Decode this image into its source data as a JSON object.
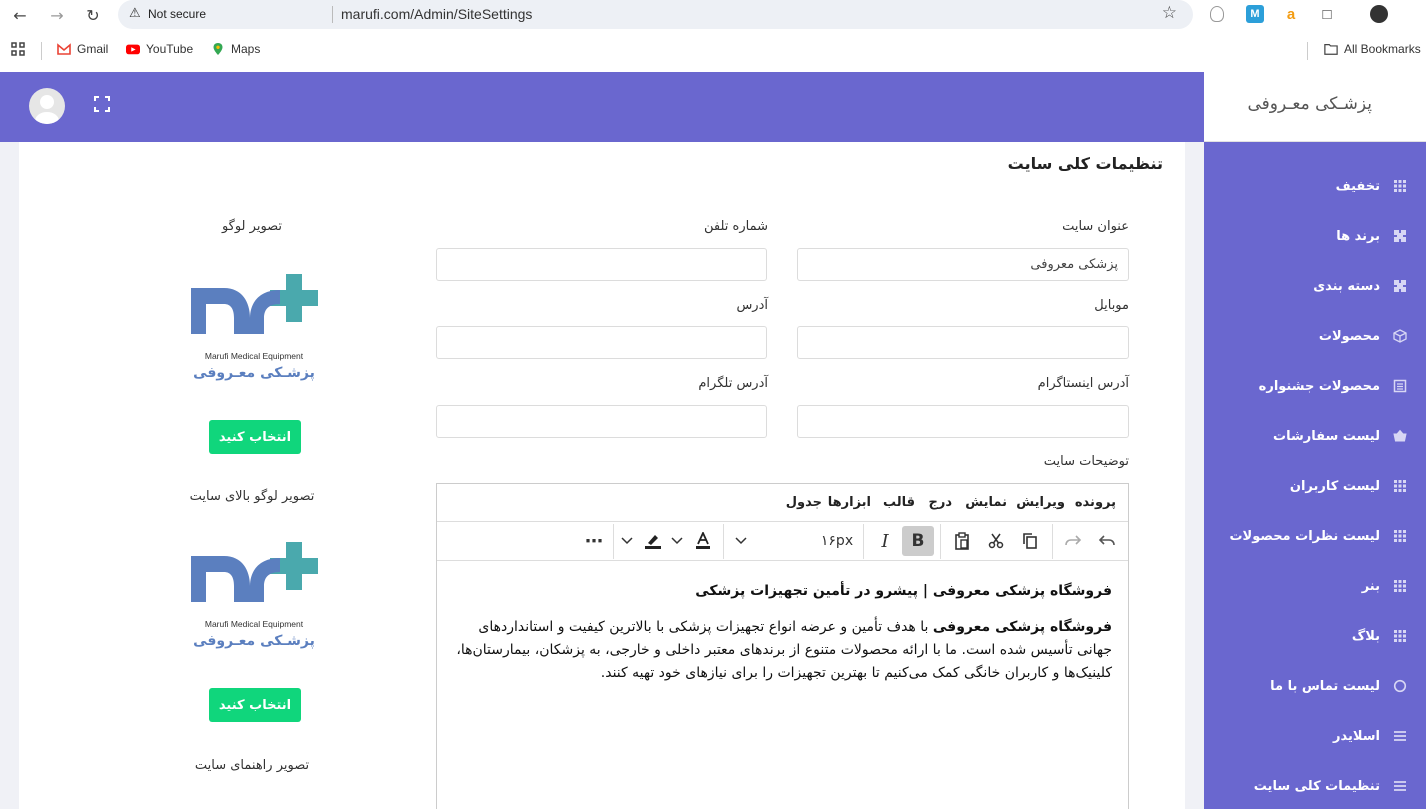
{
  "browser": {
    "security_label": "Not secure",
    "url": "marufi.com/Admin/SiteSettings",
    "bookmarks": [
      "Gmail",
      "YouTube",
      "Maps"
    ],
    "all_bookmarks": "All Bookmarks"
  },
  "brand": {
    "title": "پزشـکی معـروفی"
  },
  "sidebar": {
    "items": [
      {
        "label": "تخفیف",
        "icon": "grid-icon"
      },
      {
        "label": "برند ها",
        "icon": "puzzle-icon"
      },
      {
        "label": "دسته بندی",
        "icon": "puzzle-icon"
      },
      {
        "label": "محصولات",
        "icon": "cube-icon"
      },
      {
        "label": "محصولات جشنواره",
        "icon": "list-icon"
      },
      {
        "label": "لیست سفارشات",
        "icon": "basket-icon"
      },
      {
        "label": "لیست کاربران",
        "icon": "grid-icon"
      },
      {
        "label": "لیست نظرات محصولات",
        "icon": "grid-icon"
      },
      {
        "label": "بنر",
        "icon": "grid-icon"
      },
      {
        "label": "بلاگ",
        "icon": "grid-icon"
      },
      {
        "label": "لیست تماس با ما",
        "icon": "circle-icon"
      },
      {
        "label": "اسلایدر",
        "icon": "menu-icon"
      },
      {
        "label": "تنظیمات کلی سایت",
        "icon": "menu-icon"
      }
    ]
  },
  "page": {
    "title": "تنظیمات کلی سایت",
    "fields": {
      "site_title_label": "عنوان سایت",
      "site_title_value": "پزشکی معروفی",
      "phone_label": "شماره تلفن",
      "phone_value": "",
      "mobile_label": "موبایل",
      "mobile_value": "",
      "address_label": "آدرس",
      "address_value": "",
      "instagram_label": "آدرس اینستاگرام",
      "instagram_value": "",
      "telegram_label": "آدرس تلگرام",
      "telegram_value": "",
      "description_label": "توضیحات سایت"
    },
    "editor": {
      "menu": [
        "پرونده",
        "ویرایش",
        "نمایش",
        "درج",
        "قالب",
        "ابزارها",
        "جدول"
      ],
      "font_size": "۱۶px",
      "heading": "فروشگاه پزشکی معروفی | پیشرو در تأمین تجهیزات پزشکی",
      "paragraph_bold": "فروشگاه پزشکی معروفی",
      "paragraph_rest": " با هدف تأمین و عرضه انواع تجهیزات پزشکی با بالاترین کیفیت و استانداردهای جهانی تأسیس شده است. ما با ارائه محصولات متنوع از برندهای معتبر داخلی و خارجی، به پزشکان، بیمارستان‌ها، کلینیک‌ها و کاربران خانگی کمک می‌کنیم تا بهترین تجهیزات را برای نیازهای خود تهیه کنند."
    },
    "images": {
      "logo_label": "تصویر لوگو",
      "header_logo_label": "تصویر لوگو بالای سایت",
      "guide_label": "تصویر راهنمای سایت",
      "choose_button": "انتخاب کنید",
      "logo_caption_en": "Marufi Medical Equipment",
      "logo_caption_fa": "پزشـکی معـروفی"
    }
  },
  "colors": {
    "primary": "#6a67cf",
    "button_green": "#10d67c",
    "logo_blue": "#5b7fbf",
    "logo_teal": "#4aa9ad"
  }
}
